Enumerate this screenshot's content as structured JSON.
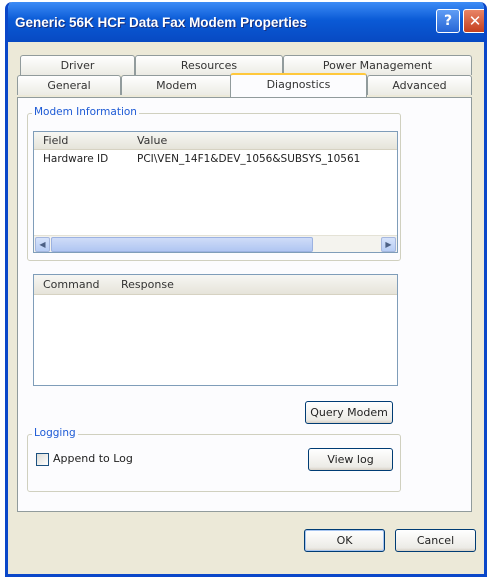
{
  "window": {
    "title": "Generic 56K HCF Data Fax Modem Properties",
    "help_label": "?",
    "close_label": "✕"
  },
  "tabs": {
    "row_back": [
      "Driver",
      "Resources",
      "Power Management"
    ],
    "row_front": [
      "General",
      "Modem",
      "Diagnostics",
      "Advanced"
    ],
    "active": "Diagnostics"
  },
  "modem_info": {
    "group_label": "Modem Information",
    "columns": [
      "Field",
      "Value"
    ],
    "rows": [
      {
        "field": "Hardware ID",
        "value": "PCI\\VEN_14F1&DEV_1056&SUBSYS_10561"
      }
    ],
    "scroll_left": "◀",
    "scroll_right": "▶"
  },
  "command_list": {
    "columns": [
      "Command",
      "Response"
    ]
  },
  "query_modem_label": "Query Modem",
  "logging": {
    "group_label": "Logging",
    "append_label": "Append to Log",
    "append_checked": false,
    "view_log_label": "View log"
  },
  "footer": {
    "ok_label": "OK",
    "cancel_label": "Cancel"
  }
}
